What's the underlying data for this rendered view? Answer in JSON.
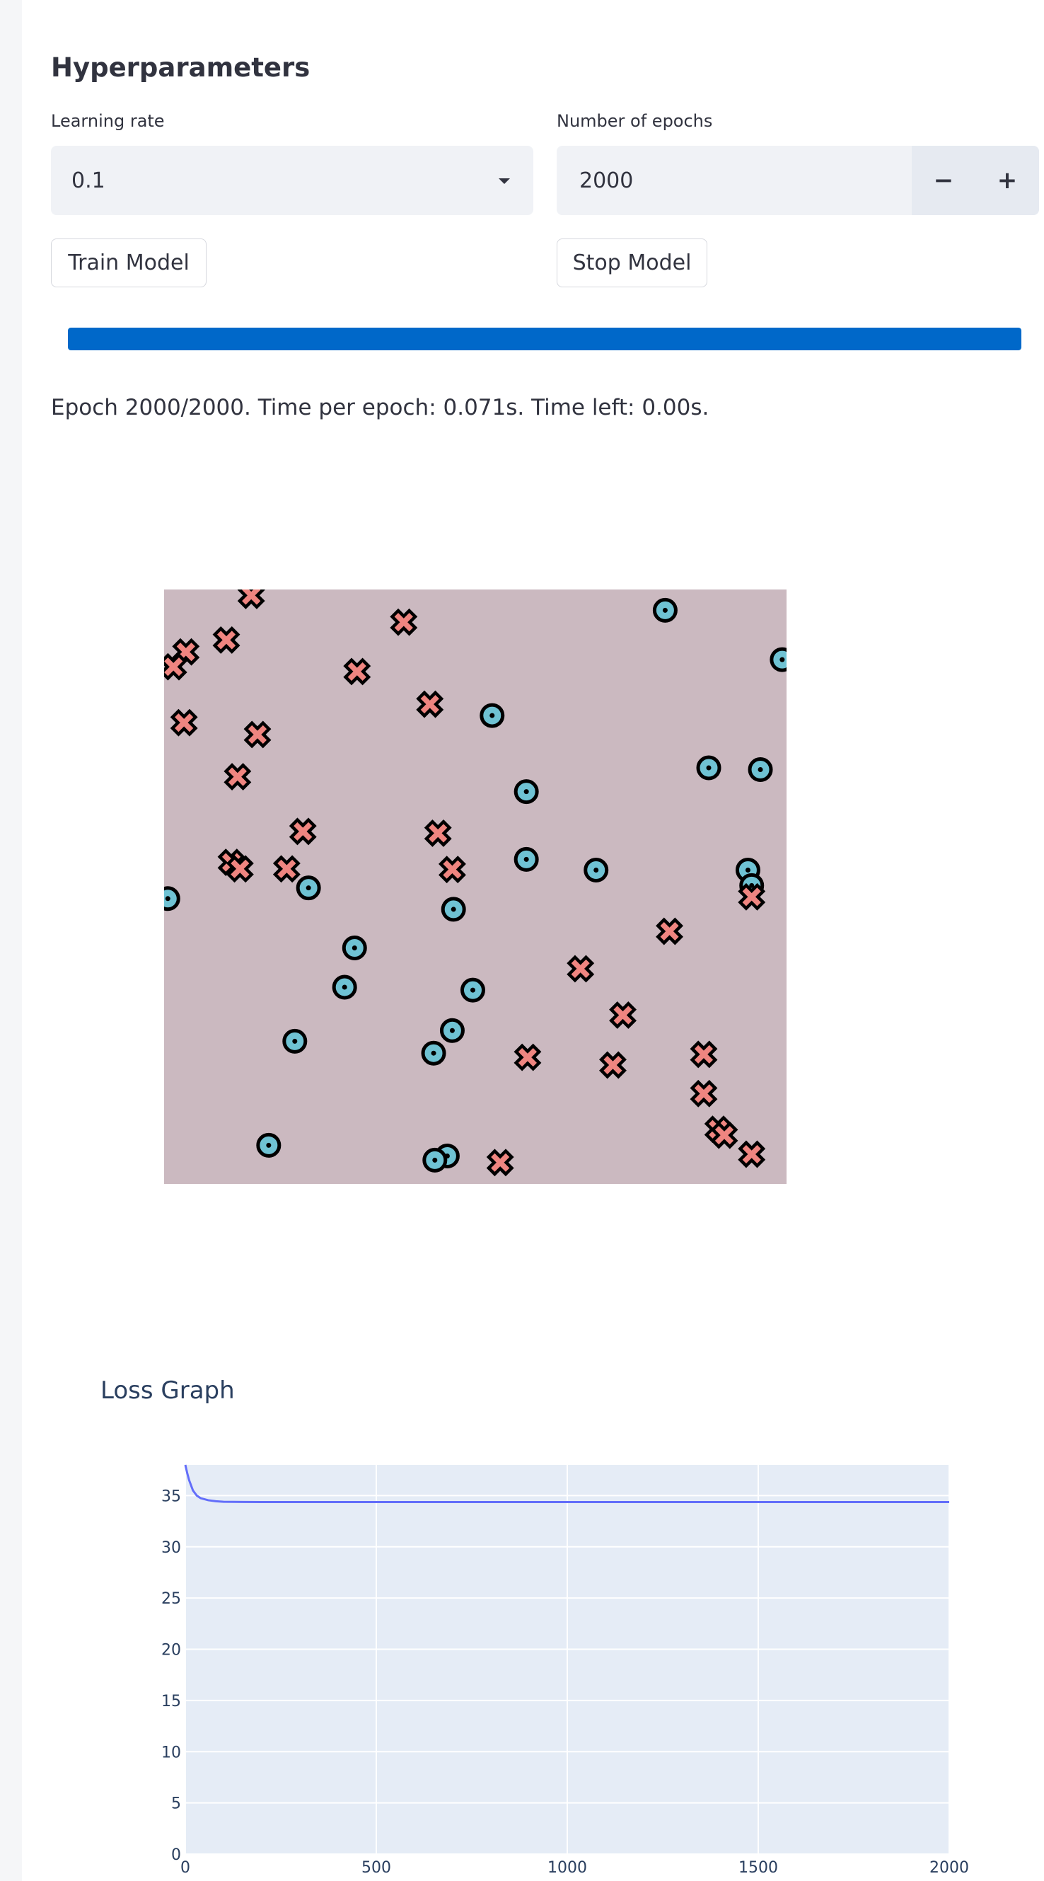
{
  "hyperparameters": {
    "heading": "Hyperparameters",
    "learning_rate": {
      "label": "Learning rate",
      "value": "0.1"
    },
    "epochs": {
      "label": "Number of epochs",
      "value": "2000",
      "minus": "−",
      "plus": "+"
    },
    "train_button": "Train Model",
    "stop_button": "Stop Model"
  },
  "progress": {
    "fraction": 1.0,
    "color": "#0068c9"
  },
  "status_text": "Epoch 2000/2000. Time per epoch: 0.071s. Time left: 0.00s.",
  "colors": {
    "background_region": "#cbb9c0",
    "class_o": "#6fc2d3",
    "class_x": "#ef8580",
    "loss_line": "#636efa",
    "plot_bg": "#e5ecf6"
  },
  "scatter_data": {
    "points": [
      {
        "c": "x",
        "x": 0.14,
        "y": 0.99
      },
      {
        "c": "x",
        "x": 0.385,
        "y": 0.945
      },
      {
        "c": "o",
        "x": 0.805,
        "y": 0.965
      },
      {
        "c": "x",
        "x": 0.1,
        "y": 0.915
      },
      {
        "c": "x",
        "x": 0.035,
        "y": 0.895
      },
      {
        "c": "x",
        "x": 0.015,
        "y": 0.87
      },
      {
        "c": "x",
        "x": 0.31,
        "y": 0.862
      },
      {
        "c": "o",
        "x": 0.993,
        "y": 0.882
      },
      {
        "c": "x",
        "x": 0.427,
        "y": 0.807
      },
      {
        "c": "o",
        "x": 0.527,
        "y": 0.788
      },
      {
        "c": "x",
        "x": 0.032,
        "y": 0.776
      },
      {
        "c": "x",
        "x": 0.15,
        "y": 0.756
      },
      {
        "c": "o",
        "x": 0.875,
        "y": 0.7
      },
      {
        "c": "o",
        "x": 0.958,
        "y": 0.697
      },
      {
        "c": "x",
        "x": 0.118,
        "y": 0.685
      },
      {
        "c": "o",
        "x": 0.582,
        "y": 0.66
      },
      {
        "c": "x",
        "x": 0.223,
        "y": 0.593
      },
      {
        "c": "x",
        "x": 0.44,
        "y": 0.59
      },
      {
        "c": "x",
        "x": 0.108,
        "y": 0.541
      },
      {
        "c": "x",
        "x": 0.122,
        "y": 0.53
      },
      {
        "c": "x",
        "x": 0.197,
        "y": 0.53
      },
      {
        "c": "x",
        "x": 0.463,
        "y": 0.529
      },
      {
        "c": "o",
        "x": 0.582,
        "y": 0.546
      },
      {
        "c": "o",
        "x": 0.694,
        "y": 0.528
      },
      {
        "c": "o",
        "x": 0.938,
        "y": 0.528
      },
      {
        "c": "o",
        "x": 0.944,
        "y": 0.502
      },
      {
        "c": "x",
        "x": 0.944,
        "y": 0.483
      },
      {
        "c": "o",
        "x": 0.232,
        "y": 0.498
      },
      {
        "c": "o",
        "x": 0.006,
        "y": 0.48
      },
      {
        "c": "o",
        "x": 0.465,
        "y": 0.462
      },
      {
        "c": "x",
        "x": 0.812,
        "y": 0.425
      },
      {
        "c": "o",
        "x": 0.306,
        "y": 0.397
      },
      {
        "c": "x",
        "x": 0.669,
        "y": 0.362
      },
      {
        "c": "o",
        "x": 0.29,
        "y": 0.331
      },
      {
        "c": "o",
        "x": 0.496,
        "y": 0.326
      },
      {
        "c": "x",
        "x": 0.737,
        "y": 0.284
      },
      {
        "c": "o",
        "x": 0.463,
        "y": 0.258
      },
      {
        "c": "o",
        "x": 0.21,
        "y": 0.24
      },
      {
        "c": "o",
        "x": 0.433,
        "y": 0.22
      },
      {
        "c": "x",
        "x": 0.584,
        "y": 0.213
      },
      {
        "c": "x",
        "x": 0.721,
        "y": 0.2
      },
      {
        "c": "x",
        "x": 0.867,
        "y": 0.218
      },
      {
        "c": "x",
        "x": 0.867,
        "y": 0.152
      },
      {
        "c": "x",
        "x": 0.89,
        "y": 0.092
      },
      {
        "c": "x",
        "x": 0.9,
        "y": 0.082
      },
      {
        "c": "x",
        "x": 0.944,
        "y": 0.05
      },
      {
        "c": "o",
        "x": 0.168,
        "y": 0.065
      },
      {
        "c": "o",
        "x": 0.455,
        "y": 0.047
      },
      {
        "c": "o",
        "x": 0.435,
        "y": 0.04
      },
      {
        "c": "x",
        "x": 0.54,
        "y": 0.036
      }
    ]
  },
  "chart_data": {
    "type": "line",
    "title": "Loss Graph",
    "xlabel": "",
    "ylabel": "",
    "xlim": [
      0,
      2000
    ],
    "ylim": [
      0,
      38
    ],
    "x_ticks": [
      0,
      500,
      1000,
      1500,
      2000
    ],
    "y_ticks": [
      0,
      5,
      10,
      15,
      20,
      25,
      30,
      35
    ],
    "grid": true,
    "series": [
      {
        "x": [
          0,
          5,
          10,
          20,
          30,
          40,
          60,
          80,
          100,
          150,
          200,
          400,
          1000,
          1500,
          2000
        ],
        "y": [
          38.0,
          37.2,
          36.5,
          35.5,
          35.0,
          34.75,
          34.55,
          34.45,
          34.4,
          34.38,
          34.37,
          34.37,
          34.37,
          34.37,
          34.37
        ]
      }
    ]
  }
}
